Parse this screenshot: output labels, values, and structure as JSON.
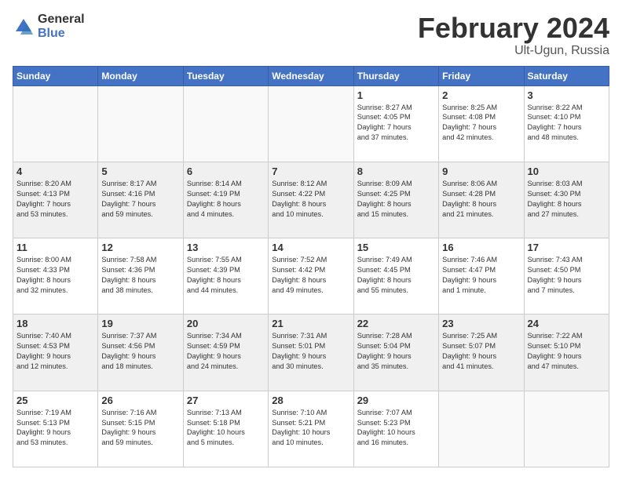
{
  "logo": {
    "general": "General",
    "blue": "Blue"
  },
  "header": {
    "title": "February 2024",
    "location": "Ult-Ugun, Russia"
  },
  "weekdays": [
    "Sunday",
    "Monday",
    "Tuesday",
    "Wednesday",
    "Thursday",
    "Friday",
    "Saturday"
  ],
  "weeks": [
    [
      {
        "day": "",
        "info": ""
      },
      {
        "day": "",
        "info": ""
      },
      {
        "day": "",
        "info": ""
      },
      {
        "day": "",
        "info": ""
      },
      {
        "day": "1",
        "info": "Sunrise: 8:27 AM\nSunset: 4:05 PM\nDaylight: 7 hours\nand 37 minutes."
      },
      {
        "day": "2",
        "info": "Sunrise: 8:25 AM\nSunset: 4:08 PM\nDaylight: 7 hours\nand 42 minutes."
      },
      {
        "day": "3",
        "info": "Sunrise: 8:22 AM\nSunset: 4:10 PM\nDaylight: 7 hours\nand 48 minutes."
      }
    ],
    [
      {
        "day": "4",
        "info": "Sunrise: 8:20 AM\nSunset: 4:13 PM\nDaylight: 7 hours\nand 53 minutes."
      },
      {
        "day": "5",
        "info": "Sunrise: 8:17 AM\nSunset: 4:16 PM\nDaylight: 7 hours\nand 59 minutes."
      },
      {
        "day": "6",
        "info": "Sunrise: 8:14 AM\nSunset: 4:19 PM\nDaylight: 8 hours\nand 4 minutes."
      },
      {
        "day": "7",
        "info": "Sunrise: 8:12 AM\nSunset: 4:22 PM\nDaylight: 8 hours\nand 10 minutes."
      },
      {
        "day": "8",
        "info": "Sunrise: 8:09 AM\nSunset: 4:25 PM\nDaylight: 8 hours\nand 15 minutes."
      },
      {
        "day": "9",
        "info": "Sunrise: 8:06 AM\nSunset: 4:28 PM\nDaylight: 8 hours\nand 21 minutes."
      },
      {
        "day": "10",
        "info": "Sunrise: 8:03 AM\nSunset: 4:30 PM\nDaylight: 8 hours\nand 27 minutes."
      }
    ],
    [
      {
        "day": "11",
        "info": "Sunrise: 8:00 AM\nSunset: 4:33 PM\nDaylight: 8 hours\nand 32 minutes."
      },
      {
        "day": "12",
        "info": "Sunrise: 7:58 AM\nSunset: 4:36 PM\nDaylight: 8 hours\nand 38 minutes."
      },
      {
        "day": "13",
        "info": "Sunrise: 7:55 AM\nSunset: 4:39 PM\nDaylight: 8 hours\nand 44 minutes."
      },
      {
        "day": "14",
        "info": "Sunrise: 7:52 AM\nSunset: 4:42 PM\nDaylight: 8 hours\nand 49 minutes."
      },
      {
        "day": "15",
        "info": "Sunrise: 7:49 AM\nSunset: 4:45 PM\nDaylight: 8 hours\nand 55 minutes."
      },
      {
        "day": "16",
        "info": "Sunrise: 7:46 AM\nSunset: 4:47 PM\nDaylight: 9 hours\nand 1 minute."
      },
      {
        "day": "17",
        "info": "Sunrise: 7:43 AM\nSunset: 4:50 PM\nDaylight: 9 hours\nand 7 minutes."
      }
    ],
    [
      {
        "day": "18",
        "info": "Sunrise: 7:40 AM\nSunset: 4:53 PM\nDaylight: 9 hours\nand 12 minutes."
      },
      {
        "day": "19",
        "info": "Sunrise: 7:37 AM\nSunset: 4:56 PM\nDaylight: 9 hours\nand 18 minutes."
      },
      {
        "day": "20",
        "info": "Sunrise: 7:34 AM\nSunset: 4:59 PM\nDaylight: 9 hours\nand 24 minutes."
      },
      {
        "day": "21",
        "info": "Sunrise: 7:31 AM\nSunset: 5:01 PM\nDaylight: 9 hours\nand 30 minutes."
      },
      {
        "day": "22",
        "info": "Sunrise: 7:28 AM\nSunset: 5:04 PM\nDaylight: 9 hours\nand 35 minutes."
      },
      {
        "day": "23",
        "info": "Sunrise: 7:25 AM\nSunset: 5:07 PM\nDaylight: 9 hours\nand 41 minutes."
      },
      {
        "day": "24",
        "info": "Sunrise: 7:22 AM\nSunset: 5:10 PM\nDaylight: 9 hours\nand 47 minutes."
      }
    ],
    [
      {
        "day": "25",
        "info": "Sunrise: 7:19 AM\nSunset: 5:13 PM\nDaylight: 9 hours\nand 53 minutes."
      },
      {
        "day": "26",
        "info": "Sunrise: 7:16 AM\nSunset: 5:15 PM\nDaylight: 9 hours\nand 59 minutes."
      },
      {
        "day": "27",
        "info": "Sunrise: 7:13 AM\nSunset: 5:18 PM\nDaylight: 10 hours\nand 5 minutes."
      },
      {
        "day": "28",
        "info": "Sunrise: 7:10 AM\nSunset: 5:21 PM\nDaylight: 10 hours\nand 10 minutes."
      },
      {
        "day": "29",
        "info": "Sunrise: 7:07 AM\nSunset: 5:23 PM\nDaylight: 10 hours\nand 16 minutes."
      },
      {
        "day": "",
        "info": ""
      },
      {
        "day": "",
        "info": ""
      }
    ]
  ]
}
